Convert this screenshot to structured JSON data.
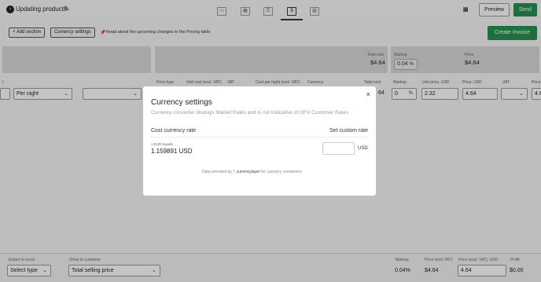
{
  "header": {
    "back_icon": "back-icon",
    "title": "Updating products",
    "edit_icon": "pencil-icon",
    "tabs": [
      "card-icon",
      "calendar-icon",
      "list-icon",
      "pricing-icon",
      "image-icon"
    ],
    "active_tab": 3,
    "tab_glyphs": [
      "▭",
      "▦",
      "☰",
      "$",
      "▧"
    ],
    "camera_icon": "camera-icon",
    "preview_label": "Preview",
    "send_label": "Send"
  },
  "toolbar": {
    "add_section_label": "+ Add section",
    "currency_settings_label": "Currency settings",
    "notice": "Read about the upcoming changes to the Pricing table",
    "create_invoice_label": "Create Invoice"
  },
  "summary": {
    "total_cost_label": "Total cost",
    "total_cost_value": "$4.64",
    "markup_label": "Markup",
    "markup_value": "0.04",
    "markup_unit": "%",
    "price_label": "Price",
    "price_value": "$4.64"
  },
  "table": {
    "headers": {
      "price_type": "Price type",
      "unit_cost": "Unit cost (excl. VAT)",
      "vat": "VAT",
      "cost_per_night": "Cost per night (excl. VAT)",
      "currency": "Currency",
      "total_cost": "Total cost",
      "markup": "Markup",
      "unit_price": "Unit price, USD",
      "price_usd": "Price, USD",
      "vat2": "VAT",
      "price_trunc": "Price"
    },
    "row": {
      "lead_cut": "t",
      "price_type": "Per night",
      "total_cost_cut": "64",
      "markup": "0",
      "markup_unit": "%",
      "unit_price": "2.32",
      "price_usd": "4.64",
      "price_trunc": "4.6"
    }
  },
  "modal": {
    "title": "Currency settings",
    "subtitle": "Currency converter displays Market Rates and is not indicative of OFX Customer Rates",
    "cost_rate_label": "Cost currency rate",
    "custom_rate_label": "Set custom rate",
    "equals_label": "1 EUR equals",
    "rate_value": "1.159891 USD",
    "custom_rate_value": "",
    "custom_rate_unit": "USD",
    "provided_by": "Data provided by",
    "provider_name": "currencylayer",
    "provider_suffix": "for currency conversion"
  },
  "footer": {
    "export_label": "Export to excel",
    "export_select": "Select type",
    "show_label": "Show to customer",
    "show_select": "Total selling price",
    "markup_label": "Markup",
    "markup_value": "0.04%",
    "price_excl_label": "Price (excl VAT)",
    "price_excl_value": "$4.64",
    "price_incl_label": "Price (excl. VAT), USD",
    "price_incl_value": "4.64",
    "profit_label": "Profit",
    "profit_value": "$0.00"
  },
  "colors": {
    "accent_green": "#26904f",
    "overlay": "#000000"
  }
}
